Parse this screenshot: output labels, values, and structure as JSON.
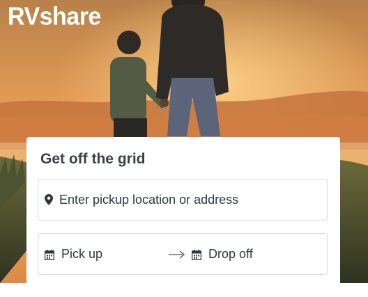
{
  "brand": {
    "name": "RVshare"
  },
  "search_card": {
    "title": "Get off the grid",
    "location_placeholder": "Enter pickup location or address",
    "pickup_label": "Pick up",
    "dropoff_label": "Drop off"
  },
  "icons": [
    "location-pin-icon",
    "calendar-icon",
    "arrow-right-icon"
  ],
  "colors": {
    "sky_top": "#c58a4c",
    "sky_glow": "#f4a65a",
    "text_dark": "#39414a",
    "card_bg": "#ffffff"
  }
}
